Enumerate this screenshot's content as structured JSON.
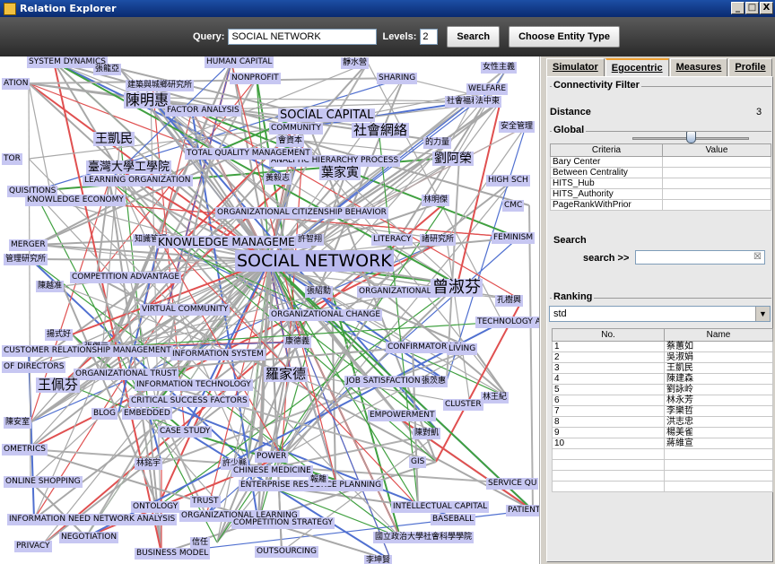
{
  "window": {
    "title": "Relation Explorer",
    "btn_min": "_",
    "btn_max": "□",
    "btn_close": "X"
  },
  "toolbar": {
    "query_label": "Query:",
    "query_value": "SOCIAL NETWORK",
    "levels_label": "Levels:",
    "levels_value": "2",
    "search_button": "Search",
    "entity_button": "Choose Entity Type"
  },
  "tabs": [
    {
      "label": "Simulator"
    },
    {
      "label": "Egocentric"
    },
    {
      "label": "Measures"
    },
    {
      "label": "Profile"
    }
  ],
  "connectivity": {
    "title": "Connectivity Filter",
    "distance_label": "Distance",
    "distance_value": "3",
    "distance_fraction": 0.5
  },
  "global": {
    "title": "Global",
    "col_criteria": "Criteria",
    "col_value": "Value",
    "rows": [
      "Bary Center",
      "Between Centrality",
      "HITS_Hub",
      "HITS_Authority",
      "PageRankWithPrior"
    ]
  },
  "search": {
    "title": "Search",
    "label": "search >>",
    "clear_icon": "☒"
  },
  "ranking": {
    "title": "Ranking",
    "selected": "std",
    "col_no": "No.",
    "col_name": "Name",
    "rows": [
      {
        "no": "1",
        "name": "蔡蕙如"
      },
      {
        "no": "2",
        "name": "吳淑娟"
      },
      {
        "no": "3",
        "name": "王凱民"
      },
      {
        "no": "4",
        "name": "陳建森"
      },
      {
        "no": "5",
        "name": "劉詠岭"
      },
      {
        "no": "6",
        "name": "林永芳"
      },
      {
        "no": "7",
        "name": "李樂哲"
      },
      {
        "no": "8",
        "name": "洪志忠"
      },
      {
        "no": "9",
        "name": "楊美雀"
      },
      {
        "no": "10",
        "name": "蔣維宣"
      }
    ]
  },
  "graph": {
    "center": "SOCIAL NETWORK",
    "labels": [
      "SYSTEM DYNAMICS",
      "張龍亞",
      "HUMAN CAPITAL",
      "靜水營",
      "女性主義",
      "ATION",
      "建築與城鄉研究所",
      "NONPROFIT",
      "SHARING",
      "WELFARE",
      "陳明惠",
      "FACTOR ANALYSIS",
      "SOCIAL CAPITAL",
      "社會福利",
      "法中東",
      "王凱民",
      "COMMUNITY",
      "社會網絡",
      "的力量",
      "安全管理",
      "會資本",
      "TOR",
      "臺灣大學工學院",
      "ANALYTIC HIERARCHY PROCESS",
      "劉阿榮",
      "TOTAL QUALITY MANAGEMENT",
      "葉家寅",
      "LEARNING ORGANIZATION",
      "黃毅志",
      "HIGH SCH",
      "QUISITIONS",
      "KNOWLEDGE ECONOMY",
      "林明傑",
      "CMC",
      "ORGANIZATIONAL CITIZENSHIP BEHAVIOR",
      "知識管理",
      "KNOWLEDGE MANAGEMENT",
      "許智翔",
      "LITERACY",
      "諸研究所",
      "MERGER",
      "FEMINISM",
      "管理研究所",
      "陳越准",
      "COMPETITION ADVANTAGE",
      "張紹勳",
      "ORGANIZATIONAL C",
      "曾淑芬",
      "孔樹興",
      "VIRTUAL COMMUNITY",
      "ORGANIZATIONAL CHANGE",
      "TECHNOLOGY A",
      "揚式好",
      "張傑元",
      "康德義",
      "CUSTOMER RELATIONSHIP MANAGEMENT",
      "INFORMATION SYSTEM",
      "CONFIRMATORY FA",
      "LIVING",
      "OF DIRECTORS",
      "ORGANIZATIONAL TRUST",
      "王佩芬",
      "羅家德",
      "INFORMATION TECHNOLOGY",
      "JOB SATISFACTION",
      "張茨惠",
      "林王紀",
      "CRITICAL SUCCESS FACTORS",
      "CLUSTER",
      "BLOG",
      "EMBEDDED",
      "EMPOWERMENT",
      "陳安室",
      "陳對凱",
      "CASE STUDY",
      "OMETRICS",
      "POWER",
      "林銘宇",
      "許少縣",
      "GIS",
      "CHINESE MEDICINE",
      "ONLINE SHOPPING",
      "ENTERPRISE RESOURCE PLANNING",
      "報離",
      "SERVICE QU",
      "TRUST",
      "ONTOLOGY",
      "INTELLECTUAL CAPITAL",
      "ORGANIZATIONAL LEARNING",
      "BASEBALL",
      "INFORMATION NEED NETWORK ANALYSIS",
      "COMPETITION STRATEGY",
      "PATIENT SAFE",
      "NEGOTIATION",
      "信任",
      "PRIVACY",
      "BUSINESS MODEL",
      "OUTSOURCING",
      "李坤賢",
      "國立政治大學社會科學學院"
    ]
  }
}
